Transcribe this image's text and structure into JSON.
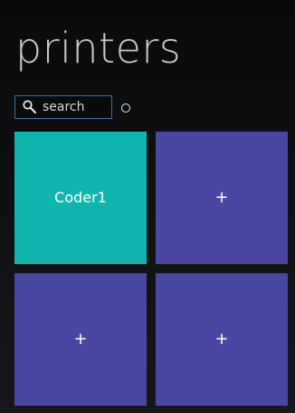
{
  "header": {
    "title": "printers"
  },
  "search": {
    "placeholder": "search",
    "value": "",
    "icon": "search-icon"
  },
  "status": {
    "indicator": "loading-indicator"
  },
  "tiles": [
    {
      "label": "Coder1",
      "kind": "printer",
      "color": "#12b5ad"
    },
    {
      "label": "+",
      "kind": "add-printer",
      "color": "#4a47a3"
    },
    {
      "label": "+",
      "kind": "add-printer",
      "color": "#4a47a3"
    },
    {
      "label": "+",
      "kind": "add-printer",
      "color": "#4a47a3"
    }
  ]
}
